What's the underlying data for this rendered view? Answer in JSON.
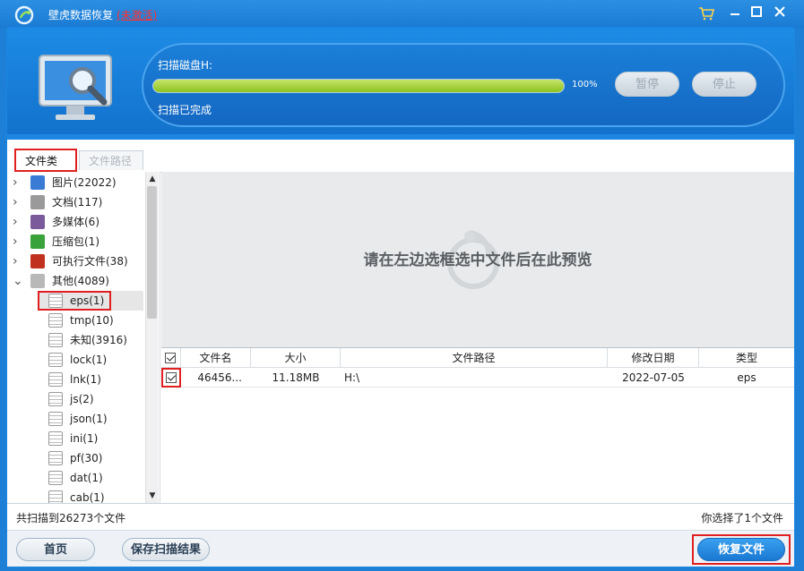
{
  "window": {
    "title": "壁虎数据恢复",
    "activation_status": "(未激活)",
    "controls": [
      "cart-icon",
      "minimize-icon",
      "maximize-icon",
      "close-icon"
    ]
  },
  "scan": {
    "label": "扫描磁盘H:",
    "progress_text": "100%",
    "progress_value": 1.0,
    "status": "扫描已完成",
    "pause_label": "暂停",
    "stop_label": "停止"
  },
  "tabs": [
    {
      "label": "文件类型",
      "active": true
    },
    {
      "label": "文件路径",
      "active": false
    }
  ],
  "tree": [
    {
      "label": "图片(22022)",
      "icon": "image-icon",
      "color": "#3a7bd5",
      "expanded": false,
      "level": 0
    },
    {
      "label": "文档(117)",
      "icon": "document-icon",
      "color": "#9a9a9a",
      "expanded": false,
      "level": 0
    },
    {
      "label": "多媒体(6)",
      "icon": "music-icon",
      "color": "#7a5a9a",
      "expanded": false,
      "level": 0
    },
    {
      "label": "压缩包(1)",
      "icon": "archive-icon",
      "color": "#39a23a",
      "expanded": false,
      "level": 0
    },
    {
      "label": "可执行文件(38)",
      "icon": "executable-icon",
      "color": "#c0321f",
      "expanded": false,
      "level": 0
    },
    {
      "label": "其他(4089)",
      "icon": "other-icon",
      "color": "#b8b8b8",
      "expanded": true,
      "level": 0
    },
    {
      "label": "eps(1)",
      "icon": "file-icon",
      "level": 1,
      "selected": true
    },
    {
      "label": "tmp(10)",
      "icon": "file-icon",
      "level": 1
    },
    {
      "label": "未知(3916)",
      "icon": "file-icon",
      "level": 1
    },
    {
      "label": "lock(1)",
      "icon": "file-icon",
      "level": 1
    },
    {
      "label": "lnk(1)",
      "icon": "file-icon",
      "level": 1
    },
    {
      "label": "js(2)",
      "icon": "file-icon",
      "level": 1
    },
    {
      "label": "json(1)",
      "icon": "file-icon",
      "level": 1
    },
    {
      "label": "ini(1)",
      "icon": "file-icon",
      "level": 1
    },
    {
      "label": "pf(30)",
      "icon": "file-icon",
      "level": 1
    },
    {
      "label": "dat(1)",
      "icon": "file-icon",
      "level": 1
    },
    {
      "label": "cab(1)",
      "icon": "file-icon",
      "level": 1
    }
  ],
  "preview": {
    "placeholder": "请在左边选框选中文件后在此预览"
  },
  "table": {
    "columns": [
      "文件名",
      "大小",
      "文件路径",
      "修改日期",
      "类型"
    ],
    "rows": [
      {
        "checked": true,
        "name": "46456...",
        "size": "11.18MB",
        "path": "H:\\",
        "date": "2022-07-05",
        "type": "eps"
      }
    ]
  },
  "status": {
    "left": "共扫描到26273个文件",
    "right": "你选择了1个文件"
  },
  "bottom": {
    "home_label": "首页",
    "save_label": "保存扫描结果",
    "recover_label": "恢复文件"
  },
  "colors": {
    "brand_blue": "#1d7fd6",
    "progress_green": "#8cc21e",
    "highlight_red": "#e02020"
  }
}
